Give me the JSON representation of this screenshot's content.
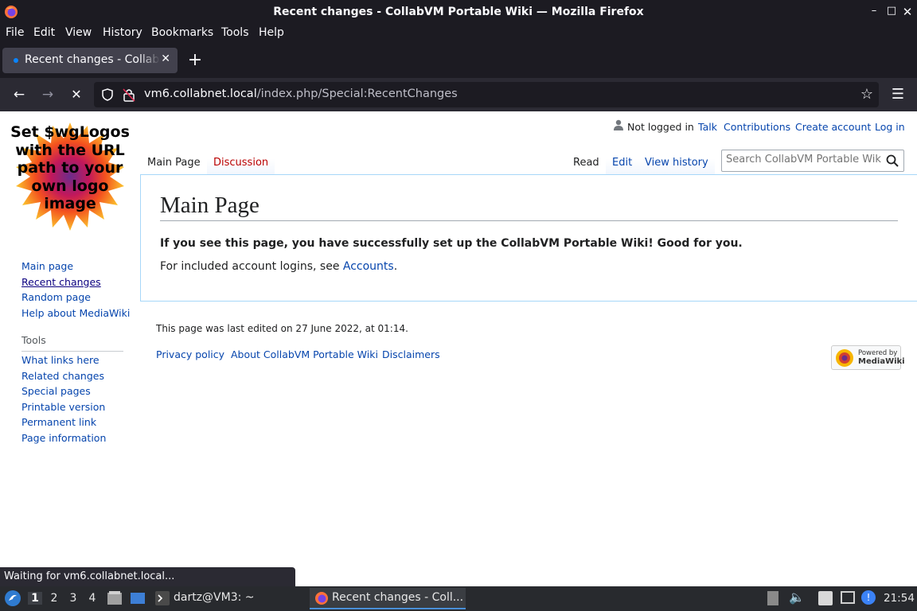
{
  "window": {
    "title": "Recent changes - CollabVM Portable Wiki — Mozilla Firefox",
    "controls": [
      "minimize-icon",
      "maximize-icon",
      "close-icon"
    ]
  },
  "menubar": {
    "items": [
      "File",
      "Edit",
      "View",
      "History",
      "Bookmarks",
      "Tools",
      "Help"
    ]
  },
  "tab": {
    "label": "Recent changes - CollabVM Portable Wiki"
  },
  "navbar": {
    "url_host": "vm6.collabnet.local",
    "url_path": "/index.php/Special:RecentChanges"
  },
  "logo": {
    "text": "Set $wgLogos with the URL path to your own logo image"
  },
  "personal": {
    "status": "Not logged in",
    "links": [
      "Talk",
      "Contributions",
      "Create account",
      "Log in"
    ]
  },
  "page_tabs": {
    "left": [
      "Main Page",
      "Discussion"
    ],
    "right": [
      "Read",
      "Edit",
      "View history"
    ]
  },
  "search": {
    "placeholder": "Search CollabVM Portable Wiki"
  },
  "content": {
    "title": "Main Page",
    "bold_text": "If you see this page, you have successfully set up the CollabVM Portable Wiki! Good for you.",
    "para_prefix": "For included account logins, see ",
    "para_link": "Accounts",
    "para_suffix": "."
  },
  "sidebar": {
    "nav": [
      "Main page",
      "Recent changes",
      "Random page",
      "Help about MediaWiki"
    ],
    "tools_heading": "Tools",
    "tools": [
      "What links here",
      "Related changes",
      "Special pages",
      "Printable version",
      "Permanent link",
      "Page information"
    ]
  },
  "footer": {
    "last_edited": "This page was last edited on 27 June 2022, at 01:14.",
    "links": [
      "Privacy policy",
      "About CollabVM Portable Wiki",
      "Disclaimers"
    ],
    "powered_line1": "Powered by",
    "powered_line2": "MediaWiki"
  },
  "status": {
    "text": "Waiting for vm6.collabnet.local..."
  },
  "taskbar": {
    "workspaces": [
      "1",
      "2",
      "3",
      "4"
    ],
    "terminal_label": "dartz@VM3: ~",
    "firefox_label": "Recent changes - Coll...",
    "clock": "21:54"
  },
  "colors": {
    "link": "#0645ad",
    "redlink": "#ba0000",
    "chrome_dark": "#1c1b22",
    "border_blue": "#a7d7f9"
  }
}
